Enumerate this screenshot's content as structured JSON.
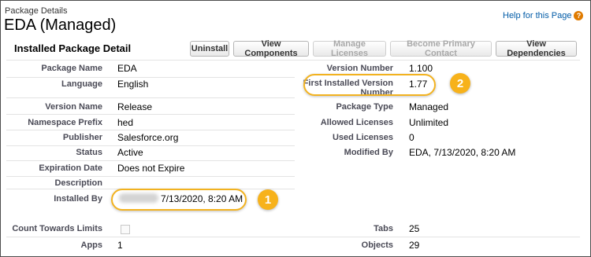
{
  "header": {
    "breadcrumb": "Package Details",
    "title": "EDA (Managed)",
    "help_link": "Help for this Page",
    "help_icon": "help-icon"
  },
  "section": {
    "title": "Installed Package Detail"
  },
  "toolbar": {
    "uninstall": "Uninstall",
    "view_components": "View Components",
    "manage_licenses": "Manage Licenses",
    "become_primary_contact": "Become Primary Contact",
    "view_dependencies": "View Dependencies"
  },
  "left_fields": [
    {
      "label": "Package Name",
      "value": "EDA"
    },
    {
      "label": "Language",
      "value": "English"
    },
    {
      "label": "Version Name",
      "value": "Release"
    },
    {
      "label": "Namespace Prefix",
      "value": "hed"
    },
    {
      "label": "Publisher",
      "value": "Salesforce.org"
    },
    {
      "label": "Status",
      "value": "Active"
    },
    {
      "label": "Expiration Date",
      "value": "Does not Expire"
    },
    {
      "label": "Description",
      "value": ""
    },
    {
      "label": "Installed By",
      "value": "7/13/2020, 8:20 AM"
    }
  ],
  "right_fields": [
    {
      "label": "Version Number",
      "value": "1.100"
    },
    {
      "label_line1": "First Installed Version",
      "label_line2": "Number",
      "value": "1.77"
    },
    {
      "label": "Package Type",
      "value": "Managed"
    },
    {
      "label": "Allowed Licenses",
      "value": "Unlimited"
    },
    {
      "label": "Used Licenses",
      "value": "0"
    },
    {
      "label": "Modified By",
      "value": "EDA, 7/13/2020, 8:20 AM"
    }
  ],
  "bottom_fields": {
    "count_towards_limits": {
      "label": "Count Towards Limits",
      "checked": false
    },
    "tabs": {
      "label": "Tabs",
      "value": "25"
    },
    "apps": {
      "label": "Apps",
      "value": "1"
    },
    "objects": {
      "label": "Objects",
      "value": "29"
    }
  },
  "callouts": {
    "one": "1",
    "two": "2",
    "color": "#f7b21b"
  },
  "colors": {
    "link": "#015ba7",
    "label": "#4a4a56",
    "highlight": "#f2b21f"
  }
}
